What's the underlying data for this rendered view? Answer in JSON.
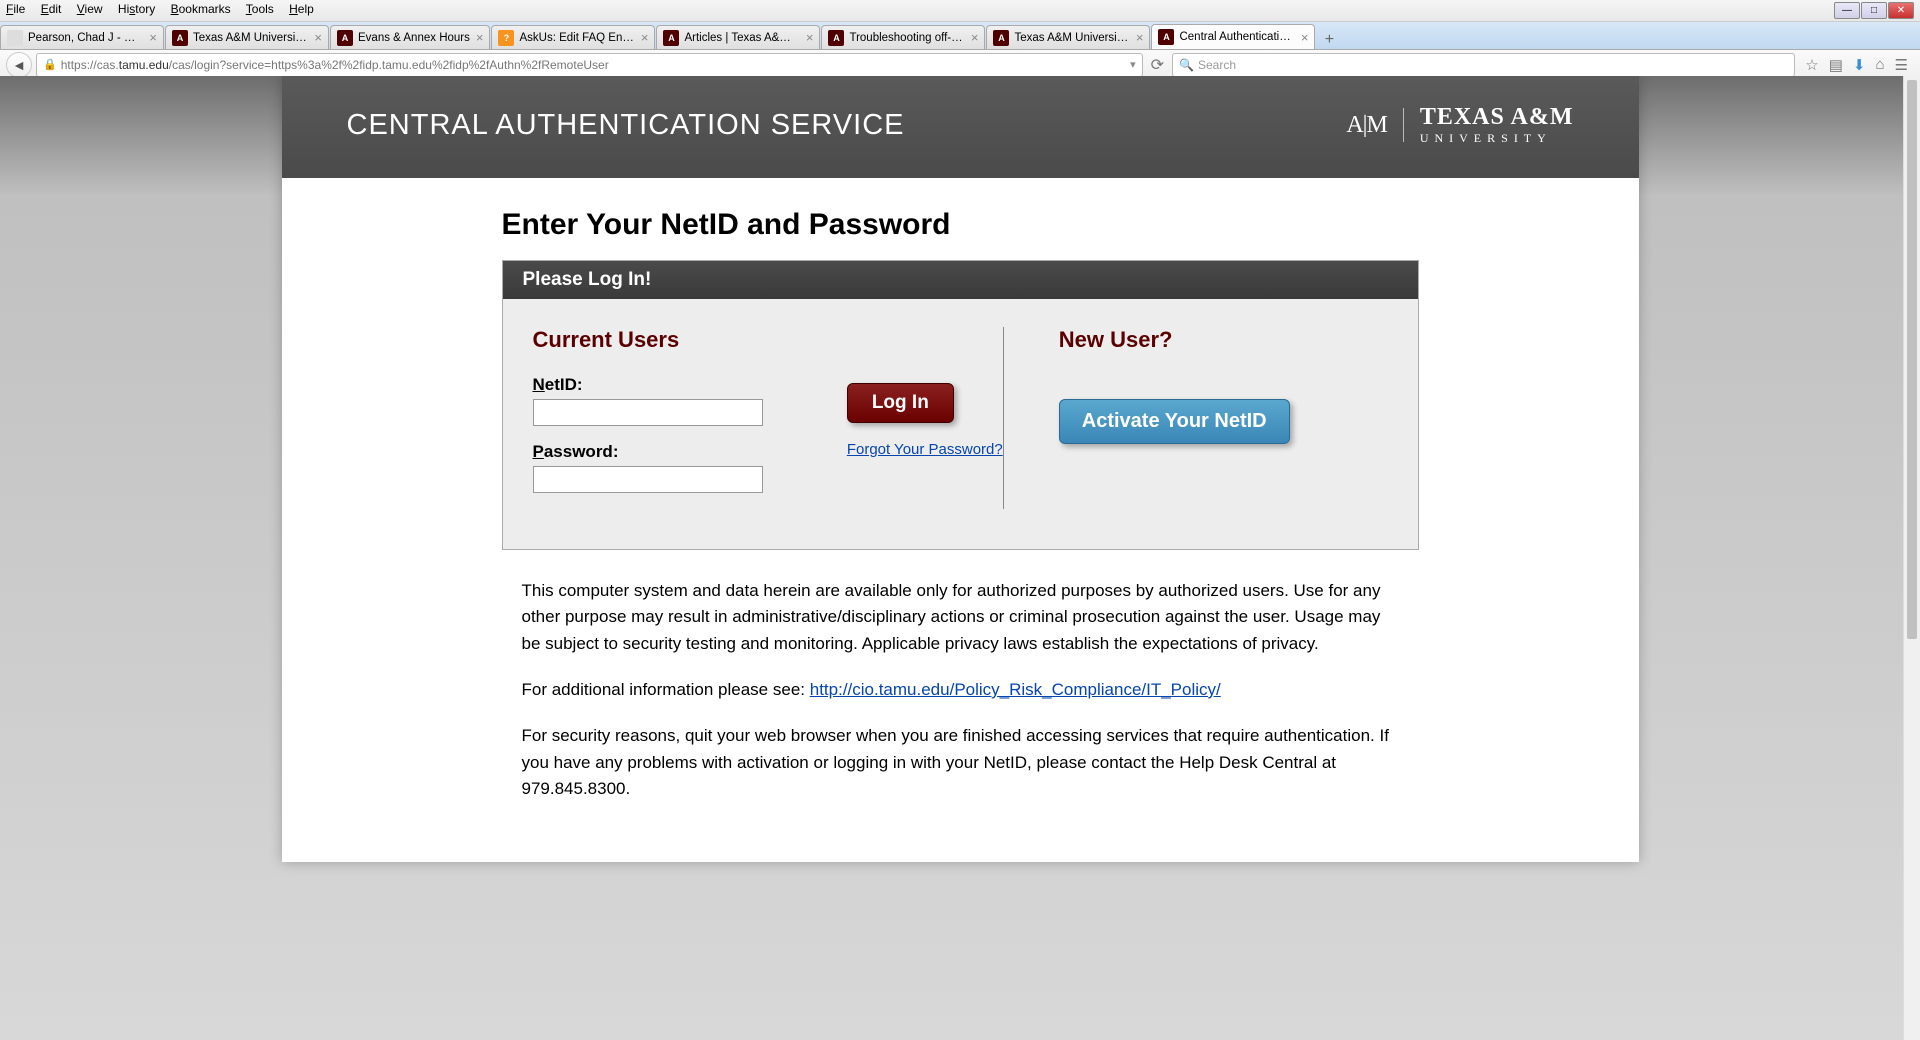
{
  "menubar": [
    "File",
    "Edit",
    "View",
    "History",
    "Bookmarks",
    "Tools",
    "Help"
  ],
  "tabs": [
    {
      "title": "Pearson, Chad J - Outlook Web...",
      "favicon": "blank",
      "active": false
    },
    {
      "title": "Texas A&M University Libr...",
      "favicon": "maroon",
      "active": false
    },
    {
      "title": "Evans & Annex Hours",
      "favicon": "maroon",
      "active": false
    },
    {
      "title": "AskUs: Edit FAQ Entry",
      "favicon": "orange",
      "active": false
    },
    {
      "title": "Articles | Texas A&M Unive...",
      "favicon": "maroon",
      "active": false
    },
    {
      "title": "Troubleshooting off-camp...",
      "favicon": "maroon",
      "active": false
    },
    {
      "title": "Texas A&M University Libr...",
      "favicon": "maroon",
      "active": false
    },
    {
      "title": "Central Authentication Ser...",
      "favicon": "maroon",
      "active": true
    }
  ],
  "url": {
    "prefix": "https://cas.",
    "domain": "tamu.edu",
    "suffix": "/cas/login?service=https%3a%2f%2fidp.tamu.edu%2fidp%2fAuthn%2fRemoteUser"
  },
  "search_placeholder": "Search",
  "header": {
    "title": "CENTRAL AUTHENTICATION SERVICE",
    "logo_mark": "A|M",
    "logo_big": "TEXAS A&M",
    "logo_small": "UNIVERSITY"
  },
  "page": {
    "heading": "Enter Your NetID and Password",
    "login_header": "Please Log In!",
    "current_users": "Current Users",
    "netid_label": "NetID:",
    "password_label": "Password:",
    "login_button": "Log In",
    "forgot_link": "Forgot Your Password?",
    "new_user": "New User?",
    "activate_button": "Activate Your NetID",
    "disclaimer1": "This computer system and data herein are available only for authorized purposes by authorized users. Use for any other purpose may result in administrative/disciplinary actions or criminal prosecution against the user. Usage may be subject to security testing and monitoring. Applicable privacy laws establish the expectations of privacy.",
    "disclaimer2_pre": "For additional information please see: ",
    "disclaimer2_link": "http://cio.tamu.edu/Policy_Risk_Compliance/IT_Policy/",
    "disclaimer3": "For security reasons, quit your web browser when you are finished accessing services that require authentication. If you have any problems with activation or logging in with your NetID, please contact the Help Desk Central at 979.845.8300."
  }
}
